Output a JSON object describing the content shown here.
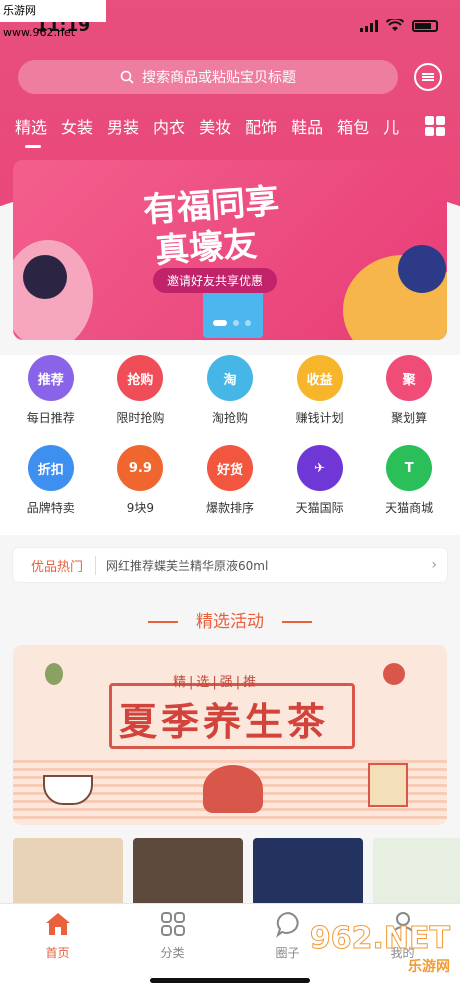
{
  "watermark": "乐游网 www.962.net",
  "status": {
    "time": "11:19"
  },
  "search": {
    "placeholder": "搜索商品或粘贴宝贝标题"
  },
  "categories": [
    "精选",
    "女装",
    "男装",
    "内衣",
    "美妆",
    "配饰",
    "鞋品",
    "箱包",
    "儿"
  ],
  "banner": {
    "title_line1": "有福同享",
    "title_line2": "真壕友",
    "pill": "邀请好友共享优惠"
  },
  "icons": [
    {
      "label": "每日推荐",
      "badge": "推荐",
      "color": "#8a64e8"
    },
    {
      "label": "限时抢购",
      "badge": "抢购",
      "color": "#ef4d58"
    },
    {
      "label": "淘抢购",
      "badge": "淘",
      "color": "#45b6e6"
    },
    {
      "label": "赚钱计划",
      "badge": "收益",
      "color": "#f6b52a"
    },
    {
      "label": "聚划算",
      "badge": "聚",
      "color": "#ef4d78"
    },
    {
      "label": "品牌特卖",
      "badge": "折扣",
      "color": "#3d8ff0"
    },
    {
      "label": "9块9",
      "badge": "9.9",
      "color": "#f0662f"
    },
    {
      "label": "爆款排序",
      "badge": "好货",
      "color": "#f2563e"
    },
    {
      "label": "天猫国际",
      "badge": "✈",
      "color": "#6f37d6"
    },
    {
      "label": "天猫商城",
      "badge": "T",
      "color": "#2bbf5a"
    }
  ],
  "hot": {
    "tag": "优品热门",
    "text": "网红推荐蝶芙兰精华原液60ml",
    "arrow": "›"
  },
  "section": {
    "title": "精选活动"
  },
  "tea": {
    "subtitle": "精|选|强|推",
    "title": "夏季养生茶"
  },
  "tabs": [
    {
      "label": "首页",
      "active": true
    },
    {
      "label": "分类",
      "active": false
    },
    {
      "label": "圈子",
      "active": false
    },
    {
      "label": "我的",
      "active": false
    }
  ],
  "logo": {
    "big": "962.NET",
    "small": "乐游网"
  }
}
